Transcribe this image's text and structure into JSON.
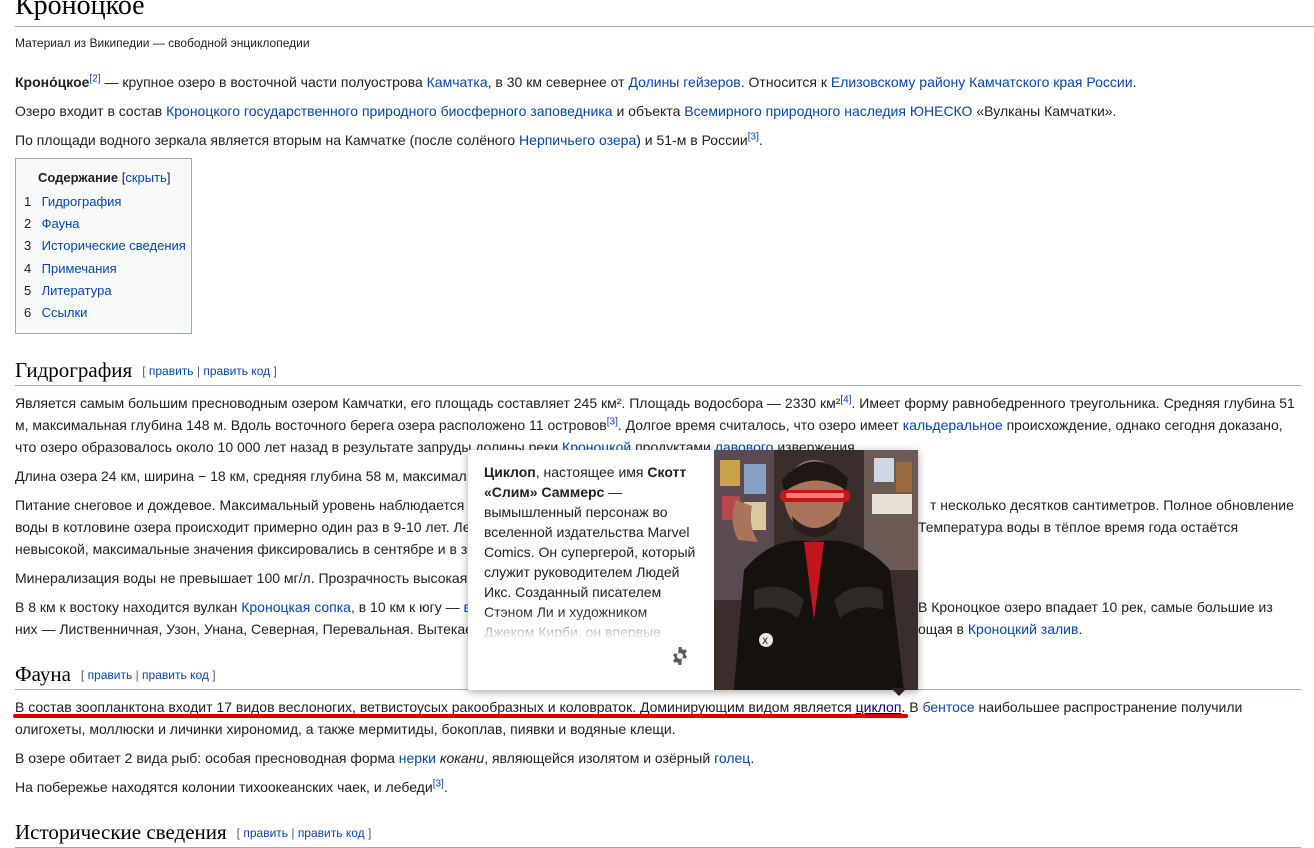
{
  "page": {
    "title": "Кроноцкое",
    "subtitle": "Материал из Википедии — свободной энциклопедии"
  },
  "intro": {
    "p1": {
      "bold": "Кроно́цкое",
      "ref": "[2]",
      "t1": " — крупное озеро в восточной части полуострова ",
      "link1": "Камчатка",
      "t2": ", в 30 км севернее от ",
      "link2": "Долины гейзеров",
      "t3": ". Относится к ",
      "link3": "Елизовскому району Камчатского края России",
      "t4": "."
    },
    "p2": {
      "t1": "Озеро входит в состав ",
      "link1": "Кроноцкого государственного природного биосферного заповедника",
      "t2": " и объекта ",
      "link2": "Всемирного природного наследия ЮНЕСКО",
      "t3": " «Вулканы Камчатки»."
    },
    "p3": {
      "t1": "По площади водного зеркала является вторым на Камчатке (после солёного ",
      "link1": "Нерпичьего озера",
      "t2": ") и 51-м в России",
      "ref": "[3]",
      "t3": "."
    }
  },
  "toc": {
    "title": "Содержание",
    "hide_open": " [",
    "hide": "скрыть",
    "hide_close": "]",
    "items": [
      {
        "num": "1",
        "label": "Гидрография"
      },
      {
        "num": "2",
        "label": "Фауна"
      },
      {
        "num": "3",
        "label": "Исторические сведения"
      },
      {
        "num": "4",
        "label": "Примечания"
      },
      {
        "num": "5",
        "label": "Литература"
      },
      {
        "num": "6",
        "label": "Ссылки"
      }
    ]
  },
  "edit_links": {
    "open": "[ ",
    "edit": "править",
    "sep": " | ",
    "edit_code": "править код",
    "close": " ]"
  },
  "hydro": {
    "heading": "Гидрография",
    "p1": {
      "t1": "Является самым большим пресноводным озером Камчатки, его площадь составляет 245 км². Площадь водосбора — 2330 км²",
      "ref1": "[4]",
      "t2": ". Имеет форму равнобедренного треугольника. Средняя глубина 51 м, максимальная глубина 148 м. Вдоль восточного берега озера расположено 11 островов",
      "ref2": "[3]",
      "t3": ". Долгое время считалось, что озеро имеет ",
      "link1": "кальдеральное",
      "t4": " происхождение, однако сегодня доказано, что озеро образовалось около 10 000 лет назад в результате запруды долины реки ",
      "link2": "Кроноцкой",
      "t5": " продуктами ",
      "link3": "лавового",
      "t6": " извержения."
    },
    "p2": "Длина озера 24 км, ширина − 18 км, средняя глубина 58 м, максимал",
    "p3": {
      "a": "Питание снеговое и дождевое. Максимальный уровень наблюдается",
      "b": "т несколько десятков сантиметров. Полное обновление",
      "c": "воды в котловине озера происходит примерно один раз в 9-10 лет. Ле",
      "d": "Температура воды в тёплое время года остаётся",
      "e": "невысокой, максимальные значения фиксировались в сентябре и в з"
    },
    "p4": "Минерализация воды не превышает 100 мг/л. Прозрачность высокая",
    "p5": {
      "a": "В 8 км к востоку находится вулкан ",
      "link1": "Кроноцкая сопка",
      "b": ", в 10 км к югу — ",
      "link_cut": "в",
      "c": "В Кроноцкое озеро впадает 10 рек, самые большие из",
      "d": "них — Лиственничная, Узон, Унана, Северная, Перевальная. Вытекае",
      "e": "ощая в ",
      "link2": "Кроноцкий залив",
      "f": "."
    }
  },
  "fauna": {
    "heading": "Фауна",
    "p1": {
      "t1": "В состав зоопланктона входит 17 видов веслоногих, ветвистоусых ракообразных и коловраток. Доминирующим видом является ",
      "link1": "циклоп",
      "t2": ". В ",
      "link2": "бентосе",
      "t3": " наибольшее распространение получили",
      "line2": "олигохеты, моллюски и личинки хирономид, а также мермитиды, бокоплав, пиявки и водяные клещи."
    },
    "p2": {
      "t1": "В озере обитает 2 вида рыб: особая пресноводная форма ",
      "link1": "нерки",
      "t2": " ",
      "italic": "кокани",
      "t3": ", являющейся изолятом и озёрный ",
      "link2": "голец",
      "t4": "."
    },
    "p3": {
      "t1": "На побережье находятся колонии тихоокеанских чаек, и лебеди",
      "ref": "[3]",
      "t2": "."
    }
  },
  "history": {
    "heading": "Исторические сведения"
  },
  "popup": {
    "b1": "Циклоп",
    "t1": ", настоящее имя ",
    "b2": "Скотт «Слим» Саммерс",
    "t2": " — вымышленный персонаж во вселенной издательства Marvel Comics. Он супергерой, который служит руководителем Людей Икс. Созданный писателем Стэном Ли и художником Джеком Кирби, он впервые появился в комиксе",
    "settings_icon": "gear-icon"
  },
  "colors": {
    "link": "#0645ad",
    "annotation": "#e00000"
  }
}
